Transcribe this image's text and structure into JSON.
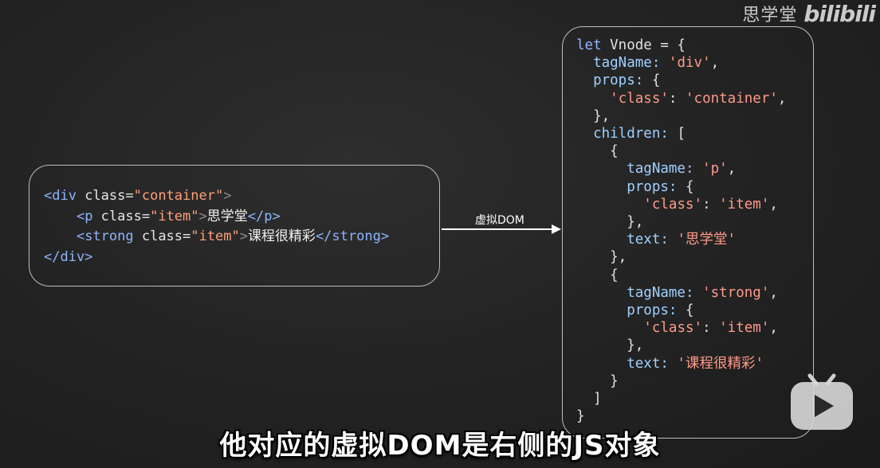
{
  "watermark": {
    "brand": "思学堂",
    "logo": "bilibili"
  },
  "html_snippet": {
    "line1_open": "<div",
    "line1_attr": " class=",
    "line1_val": "\"container\"",
    "line1_close": ">",
    "line2_open": "<p",
    "line2_attr": " class=",
    "line2_val": "\"item\"",
    "line2_gt": ">",
    "line2_text": "思学堂",
    "line2_end": "</p>",
    "line3_open": "<strong",
    "line3_attr": " class=",
    "line3_val": "\"item\"",
    "line3_gt": ">",
    "line3_text": "课程很精彩",
    "line3_end": "</strong>",
    "line4_end": "</div>"
  },
  "arrow": {
    "label": "虚拟DOM"
  },
  "vnode_code": {
    "l1_kw": "let",
    "l1_rest": " Vnode = {",
    "tagName_key": "tagName:",
    "tagName_val": "'div'",
    "props_key": "props:",
    "class_key": "'class'",
    "class_val": "'container'",
    "children_key": "children:",
    "child1_tag": "'p'",
    "child1_class": "'item'",
    "child1_text": "'思学堂'",
    "child2_tag": "'strong'",
    "child2_class": "'item'",
    "child2_text": "'课程很精彩'",
    "text_key": "text:"
  },
  "subtitle": "他对应的虚拟DOM是右侧的JS对象",
  "icons": {
    "player": "tv-play-icon"
  },
  "colors": {
    "background": "#242424",
    "tag": "#8fb4ff",
    "string": "#ffa07a",
    "border": "#bdbdbd"
  }
}
